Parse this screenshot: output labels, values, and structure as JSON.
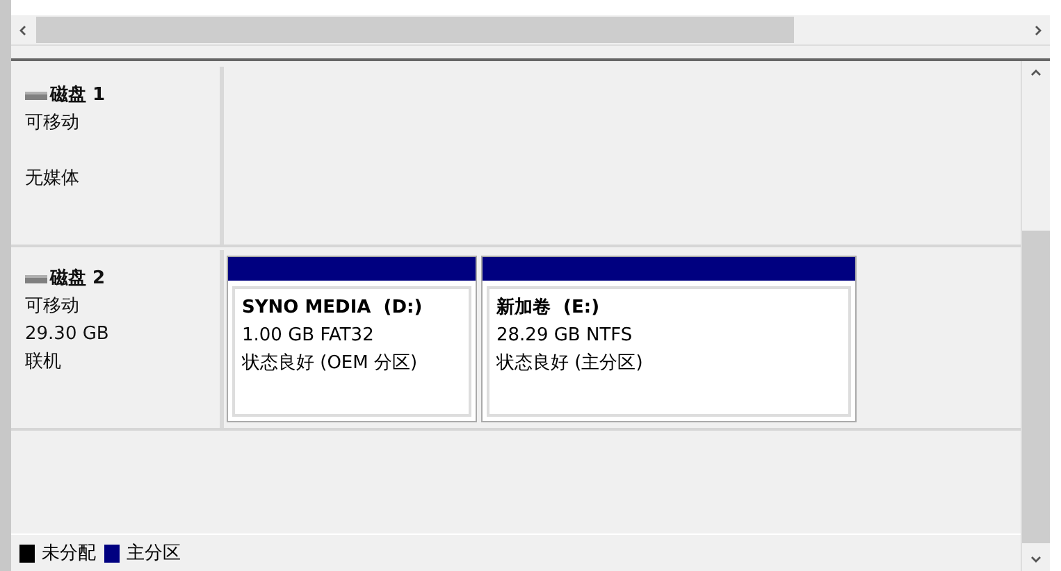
{
  "disks": [
    {
      "name": "磁盘 1",
      "type": "可移动",
      "status": "无媒体"
    },
    {
      "name": "磁盘 2",
      "type": "可移动",
      "capacity": "29.30 GB",
      "status": "联机",
      "partitions": [
        {
          "title": "SYNO MEDIA  (D:)",
          "size": "1.00 GB FAT32",
          "status": "状态良好 (OEM 分区)",
          "color": "#000080"
        },
        {
          "title": "新加卷  (E:)",
          "size": "28.29 GB NTFS",
          "status": "状态良好 (主分区)",
          "color": "#000080"
        }
      ]
    }
  ],
  "legend": [
    {
      "label": "未分配",
      "color": "#000000"
    },
    {
      "label": "主分区",
      "color": "#000080"
    }
  ]
}
